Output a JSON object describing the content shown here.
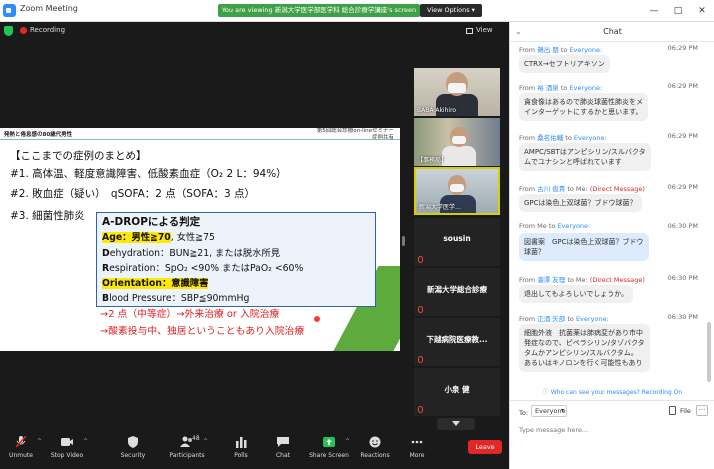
{
  "window": {
    "title": "Zoom Meeting",
    "viewing_banner": "You are viewing 新潟大学医学部医学科 総合診療学講座's screen",
    "view_options": "View Options ▾",
    "controls": {
      "minimize": "—",
      "maximize": "□",
      "close": "✕"
    }
  },
  "meeting_bar": {
    "recording": "Recording",
    "view": "View"
  },
  "slide": {
    "tag": "発熱と倦怠感の80歳代男性",
    "header_right_1": "第5回総合診療on-lineセミナー",
    "header_right_2": "症例共有",
    "line1": "【ここまでの症例のまとめ】",
    "line2": "#1. 高体温、軽度意識障害、低酸素血症（O₂ 2 L：94%）",
    "line3": "#2. 敗血症（疑い）　qSOFA：2 点（SOFA：3 点）",
    "line4": "#3. 細菌性肺炎",
    "adrop_title": "A-DROPによる判定",
    "age_hl": "Age：男性≧70",
    "age_rest": ", 女性≧75",
    "dehydration_lead": "D",
    "dehydration": "ehydration：BUN≧21, または脱水所見",
    "respiration_lead": "R",
    "respiration": "espiration：SpO₂ <90% またはPaO₂ <60%",
    "orientation_hl": "Orientation：意識障害",
    "pressure_lead": "B",
    "pressure": "lood Pressure：SBP≦90mmHg",
    "red1": "→2 点（中等症）→外来治療 or 入院治療",
    "red2": "→酸素投与中、独居ということもあり入院治療"
  },
  "participants": [
    {
      "name": "BABA Akihiro",
      "video": true
    },
    {
      "name": "【事務局】",
      "video": true
    },
    {
      "name": "新潟大学医学...",
      "video": true,
      "active": true
    },
    {
      "name": "sousin",
      "video": false
    },
    {
      "name": "新潟大学総合診療",
      "video": false
    },
    {
      "name": "下越病院医療教...",
      "video": false
    },
    {
      "name": "小泉 健",
      "video": false
    }
  ],
  "toolbar": {
    "unmute": "Unmute",
    "stop_video": "Stop Video",
    "security": "Security",
    "participants": "Participants",
    "participants_count": "48",
    "polls": "Polls",
    "chat": "Chat",
    "share_screen": "Share Screen",
    "reactions": "Reactions",
    "more": "More",
    "leave": "Leave"
  },
  "chat": {
    "title": "Chat",
    "messages": [
      {
        "from": "From",
        "sender": "鵜出 朋",
        "to": "to",
        "recipient": "Everyone:",
        "dm": "",
        "time": "06:29 PM",
        "text": [
          "CTRX→セフトリアキソン"
        ]
      },
      {
        "from": "From",
        "sender": "裕 酒泉",
        "to": "to",
        "recipient": "Everyone:",
        "dm": "",
        "time": "06:29 PM",
        "text": [
          "貪食像はあるので肺炎球菌性肺炎をメ",
          "インターゲットにするかと思います。"
        ]
      },
      {
        "from": "From",
        "sender": "桑名佑輔",
        "to": "to",
        "recipient": "Everyone:",
        "dm": "",
        "time": "06:29 PM",
        "text": [
          "AMPC/SBTはアンピシリン/スルバクタ",
          "ムでユナシンと呼ばれています"
        ]
      },
      {
        "from": "From",
        "sender": "古川 俊貴",
        "to": "to Me:",
        "recipient": "",
        "dm": "(Direct Message)",
        "time": "06:29 PM",
        "text": [
          "GPCは染色上双球菌？ブドウ球菌？"
        ]
      },
      {
        "from": "From Me",
        "sender": "",
        "to": "to",
        "recipient": "Everyone:",
        "dm": "",
        "time": "06:30 PM",
        "text": [
          "図書案　GPCは染色上双球菌？ブドウ",
          "球菌？"
        ],
        "me": true
      },
      {
        "from": "From",
        "sender": "瀧澤 友理",
        "to": "to Me:",
        "recipient": "",
        "dm": "(Direct Message)",
        "time": "06:30 PM",
        "text": [
          "退出してもよろしいでしょうか。"
        ]
      },
      {
        "from": "From",
        "sender": "正酒 矢部",
        "to": "to",
        "recipient": "Everyone:",
        "dm": "",
        "time": "06:30 PM",
        "text": [
          "細胞外液　抗菌薬は肺病変があり市中",
          "発症なので、ピペラシリン/タゾバクタ",
          "タムかアンピシリン/スルバクタム。",
          "あるいはキノロンを行く可能性もあり"
        ]
      }
    ],
    "who_can_see": "Who can see your messages? Recording On",
    "to_label": "To:",
    "to_value": "Everyone",
    "file_label": "File",
    "more_label": "···",
    "input_placeholder": "Type message here..."
  },
  "colors": {
    "zoom_blue": "#2d8cff",
    "banner_green": "#3fa147",
    "leave_red": "#e02828",
    "highlight_yellow": "#ffe900",
    "slide_red": "#e02020"
  }
}
